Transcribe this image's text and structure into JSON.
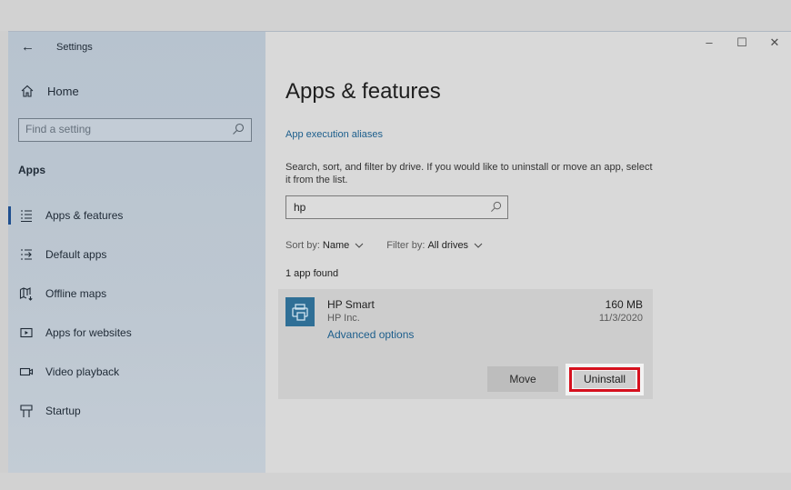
{
  "window": {
    "title": "Settings",
    "controls": {
      "minimize": "–",
      "maximize": "☐",
      "close": "✕"
    }
  },
  "sidebar": {
    "home_label": "Home",
    "search_placeholder": "Find a setting",
    "section_title": "Apps",
    "items": [
      {
        "label": "Apps & features",
        "icon": "list-icon",
        "active": true
      },
      {
        "label": "Default apps",
        "icon": "default-apps-icon",
        "active": false
      },
      {
        "label": "Offline maps",
        "icon": "map-icon",
        "active": false
      },
      {
        "label": "Apps for websites",
        "icon": "website-icon",
        "active": false
      },
      {
        "label": "Video playback",
        "icon": "video-icon",
        "active": false
      },
      {
        "label": "Startup",
        "icon": "startup-icon",
        "active": false
      }
    ]
  },
  "main": {
    "page_title": "Apps & features",
    "alias_link": "App execution aliases",
    "description": "Search, sort, and filter by drive. If you would like to uninstall or move an app, select it from the list.",
    "search_value": "hp",
    "sort_label": "Sort by:",
    "sort_value": "Name",
    "filter_label": "Filter by:",
    "filter_value": "All drives",
    "found_text": "1 app found",
    "app": {
      "name": "HP Smart",
      "publisher": "HP Inc.",
      "advanced": "Advanced options",
      "size": "160 MB",
      "date": "11/3/2020",
      "move_label": "Move",
      "uninstall_label": "Uninstall"
    }
  },
  "colors": {
    "highlight": "#d6111e",
    "link": "#1c5e8c",
    "app_tile": "#2f6f96"
  }
}
